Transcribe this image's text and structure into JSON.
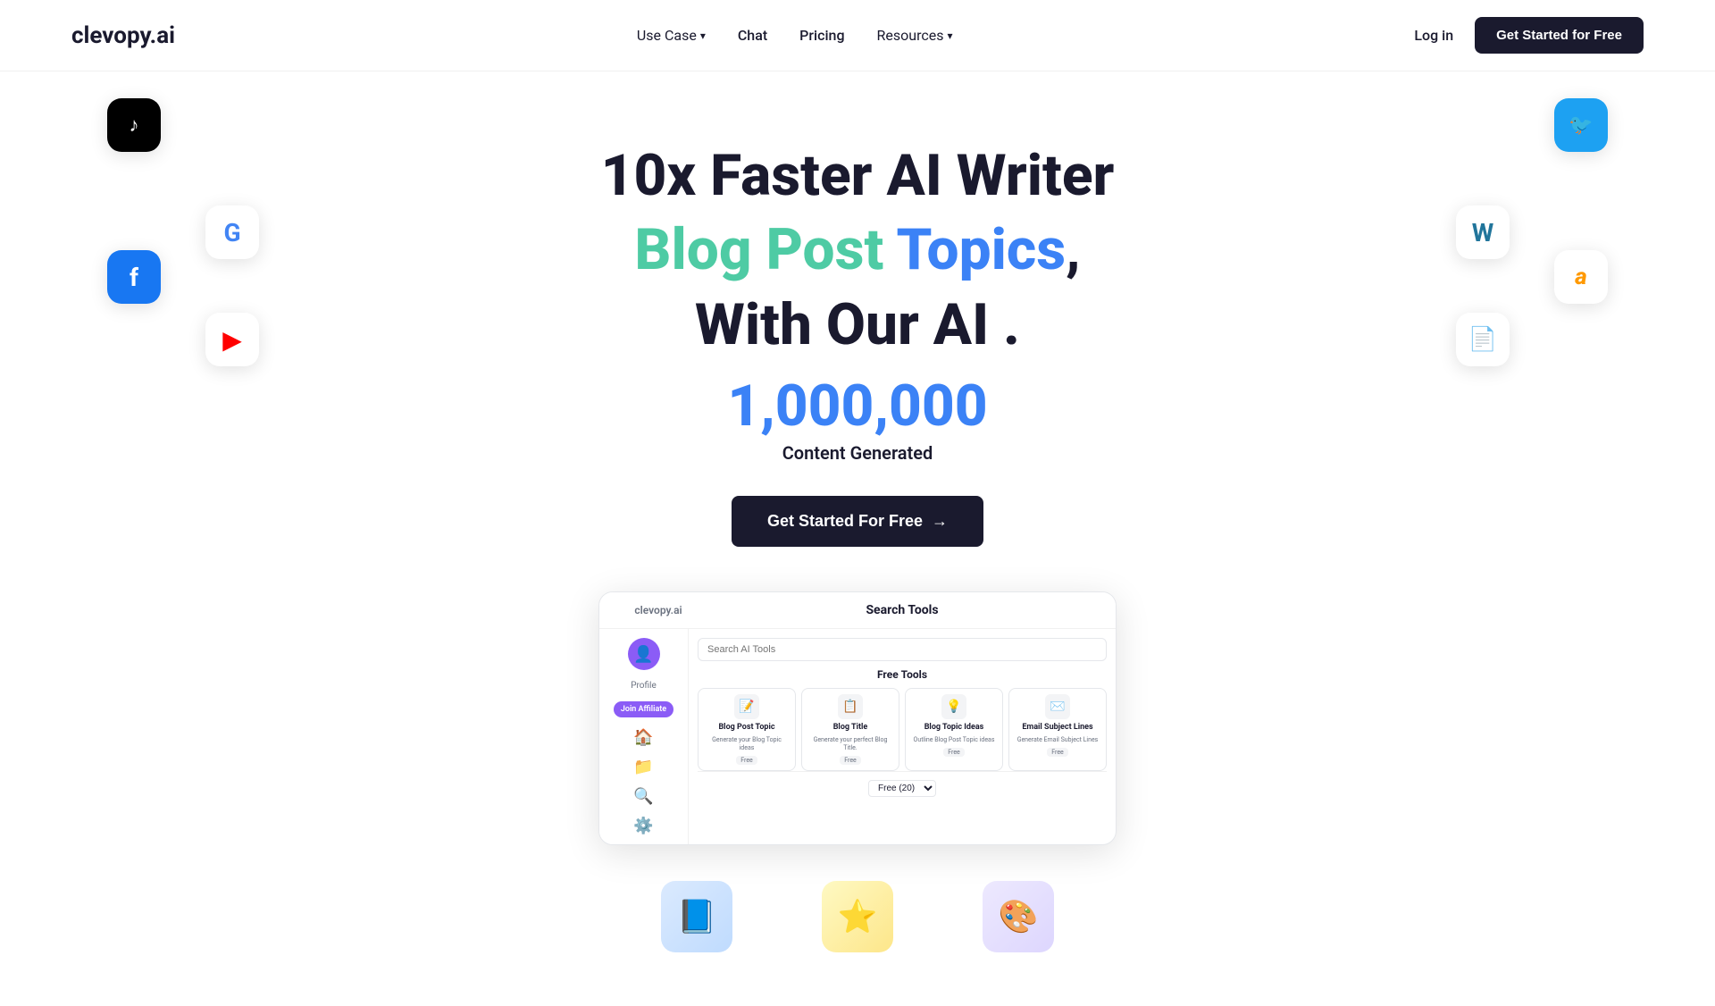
{
  "nav": {
    "logo": "clevopy.ai",
    "links": [
      {
        "id": "use-case",
        "label": "Use Case",
        "hasDropdown": true
      },
      {
        "id": "chat",
        "label": "Chat",
        "hasDropdown": false
      },
      {
        "id": "pricing",
        "label": "Pricing",
        "hasDropdown": false
      },
      {
        "id": "resources",
        "label": "Resources",
        "hasDropdown": true
      }
    ],
    "login_label": "Log in",
    "cta_label": "Get Started for Free"
  },
  "hero": {
    "headline1": "10x Faster AI Writer",
    "headline2_word1": "Blog",
    "headline2_word2": "Post",
    "headline2_word3": "Topics",
    "headline2_cursor": ",",
    "headline3": "With Our AI .",
    "count": "1,000,000",
    "count_sub": "Content Generated",
    "cta_label": "Get Started For Free",
    "cta_arrow": "→"
  },
  "floating_icons": [
    {
      "id": "tiktok",
      "symbol": "♪",
      "label": "TikTok icon"
    },
    {
      "id": "google",
      "symbol": "G",
      "label": "Google icon"
    },
    {
      "id": "facebook",
      "symbol": "f",
      "label": "Facebook icon"
    },
    {
      "id": "youtube",
      "symbol": "▶",
      "label": "YouTube icon"
    },
    {
      "id": "twitter",
      "symbol": "🐦",
      "label": "Twitter icon"
    },
    {
      "id": "wordpress",
      "symbol": "W",
      "label": "WordPress icon"
    },
    {
      "id": "amazon",
      "symbol": "a",
      "label": "Amazon icon"
    },
    {
      "id": "pdf",
      "symbol": "📄",
      "label": "PDF icon"
    }
  ],
  "dashboard": {
    "brand": "clevopy.ai",
    "search_tools_title": "Search Tools",
    "search_placeholder": "Search AI Tools",
    "free_label": "Free",
    "tools_label": "Tools",
    "profile_label": "Profile",
    "affiliate_label": "Join Affiliate",
    "tools": [
      {
        "name": "Blog Post Topic",
        "desc": "Generate your Blog Topic ideas",
        "badge": "Free",
        "icon": "📝"
      },
      {
        "name": "Blog Title",
        "desc": "Generate your perfect Blog Title.",
        "badge": "Free",
        "icon": "📋"
      },
      {
        "name": "Blog Topic Ideas",
        "desc": "Outline Blog Post Topic ideas",
        "badge": "Free",
        "icon": "💡"
      },
      {
        "name": "Email Subject Lines",
        "desc": "Generate Email Subject Lines",
        "badge": "Free",
        "icon": "✉️"
      }
    ],
    "filter_label": "Free (20)"
  },
  "bottom_items": [
    {
      "id": "blue-illus",
      "emoji": "📘",
      "style": "blue"
    },
    {
      "id": "yellow-illus",
      "emoji": "⭐",
      "style": "yellow"
    },
    {
      "id": "purple-illus",
      "emoji": "🎨",
      "style": "purple"
    }
  ]
}
